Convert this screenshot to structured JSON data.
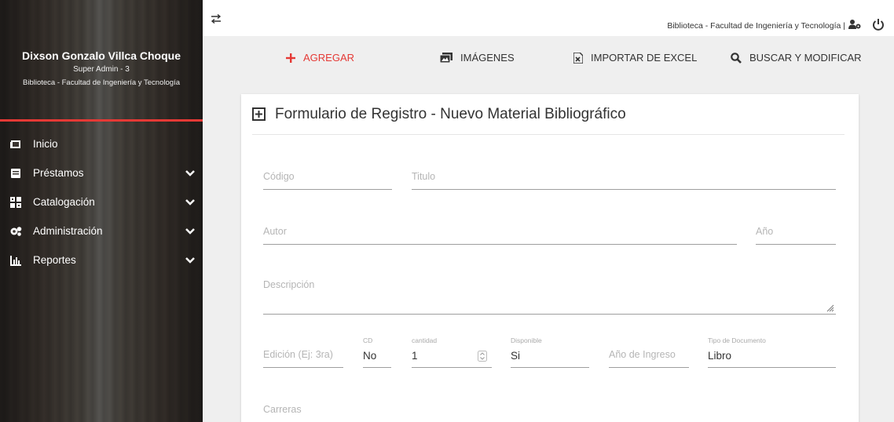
{
  "sidebar": {
    "user_name": "Dixson Gonzalo Villca Choque",
    "user_role": "Super Admin - 3",
    "library": "Biblioteca - Facultad de Ingeniería y Tecnología",
    "items": [
      {
        "label": "Inicio",
        "icon": "tablet-icon",
        "expandable": false
      },
      {
        "label": "Préstamos",
        "icon": "book-icon",
        "expandable": true
      },
      {
        "label": "Catalogación",
        "icon": "grid-icon",
        "expandable": true
      },
      {
        "label": "Administración",
        "icon": "gears-icon",
        "expandable": true
      },
      {
        "label": "Reportes",
        "icon": "bar-chart-icon",
        "expandable": true
      }
    ]
  },
  "topbar": {
    "library": "Biblioteca - Facultad de Ingeniería y Tecnología |"
  },
  "actions": {
    "add": "AGREGAR",
    "images": "IMÁGENES",
    "import_excel": "IMPORTAR DE EXCEL",
    "search_modify": "BUSCAR Y MODIFICAR"
  },
  "form": {
    "title": "Formulario de Registro - Nuevo Material Bibliográfico",
    "codigo_placeholder": "Código",
    "titulo_placeholder": "Titulo",
    "autor_placeholder": "Autor",
    "anio_placeholder": "Año",
    "descripcion_placeholder": "Descripción",
    "edicion_placeholder": "Edición (Ej: 3ra)",
    "cd_label": "CD",
    "cd_value": "No",
    "cantidad_label": "cantidad",
    "cantidad_value": "1",
    "disponible_label": "Disponible",
    "disponible_value": "Si",
    "anio_ingreso_placeholder": "Año de Ingreso",
    "tipo_label": "Tipo de Documento",
    "tipo_value": "Libro",
    "carreras_placeholder": "Carreras"
  },
  "colors": {
    "accent": "#e53935",
    "text": "#333333",
    "placeholder": "#b5b5b5"
  }
}
